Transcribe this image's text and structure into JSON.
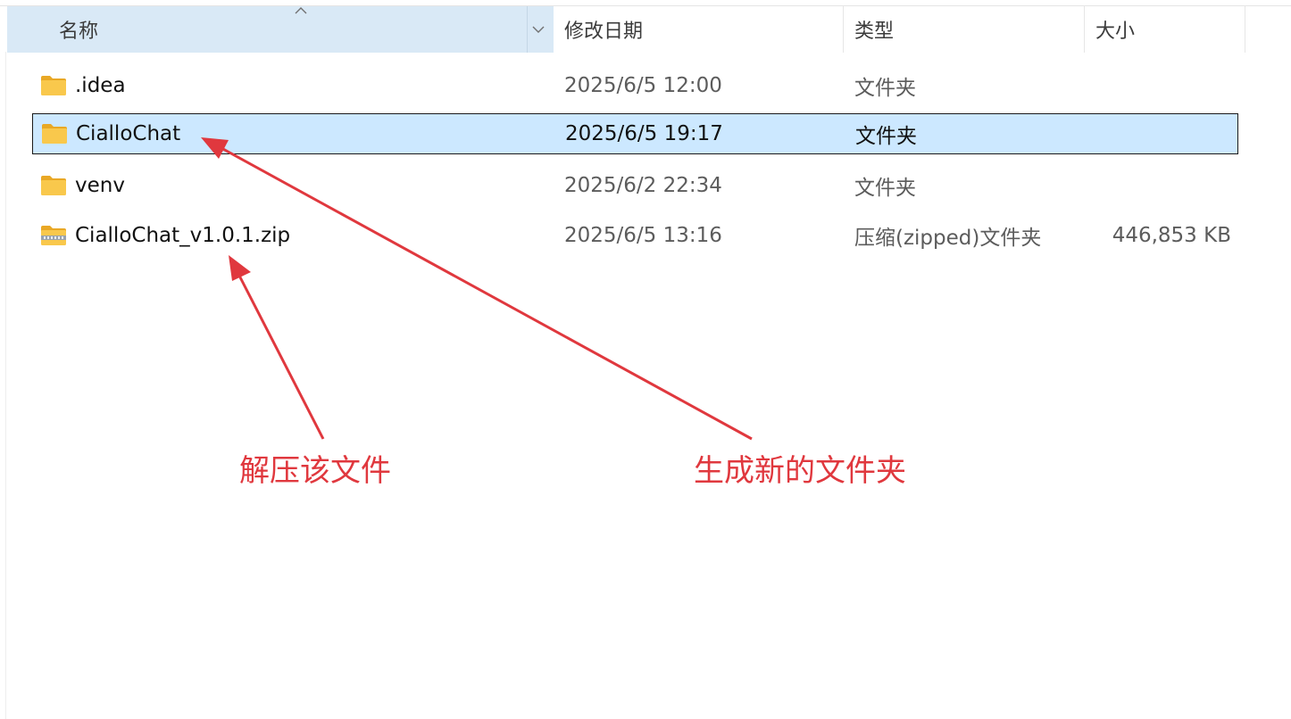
{
  "header": {
    "name": "名称",
    "date_modified": "修改日期",
    "type": "类型",
    "size": "大小"
  },
  "rows": [
    {
      "name": ".idea",
      "date": "2025/6/5 12:00",
      "type": "文件夹",
      "size": "",
      "icon": "folder-icon",
      "selected": false
    },
    {
      "name": "CialloChat",
      "date": "2025/6/5 19:17",
      "type": "文件夹",
      "size": "",
      "icon": "folder-icon",
      "selected": true
    },
    {
      "name": "venv",
      "date": "2025/6/2 22:34",
      "type": "文件夹",
      "size": "",
      "icon": "folder-icon",
      "selected": false
    },
    {
      "name": "CialloChat_v1.0.1.zip",
      "date": "2025/6/5 13:16",
      "type": "压缩(zipped)文件夹",
      "size": "446,853 KB",
      "icon": "zip-folder-icon",
      "selected": false
    }
  ],
  "annotations": {
    "extract_label": "解压该文件",
    "new_folder_label": "生成新的文件夹"
  },
  "colors": {
    "header_selected_bg": "#d9e9f6",
    "row_selected_bg": "#cce8ff",
    "annotation": "#e0383e",
    "folder": "#f8c64a"
  }
}
